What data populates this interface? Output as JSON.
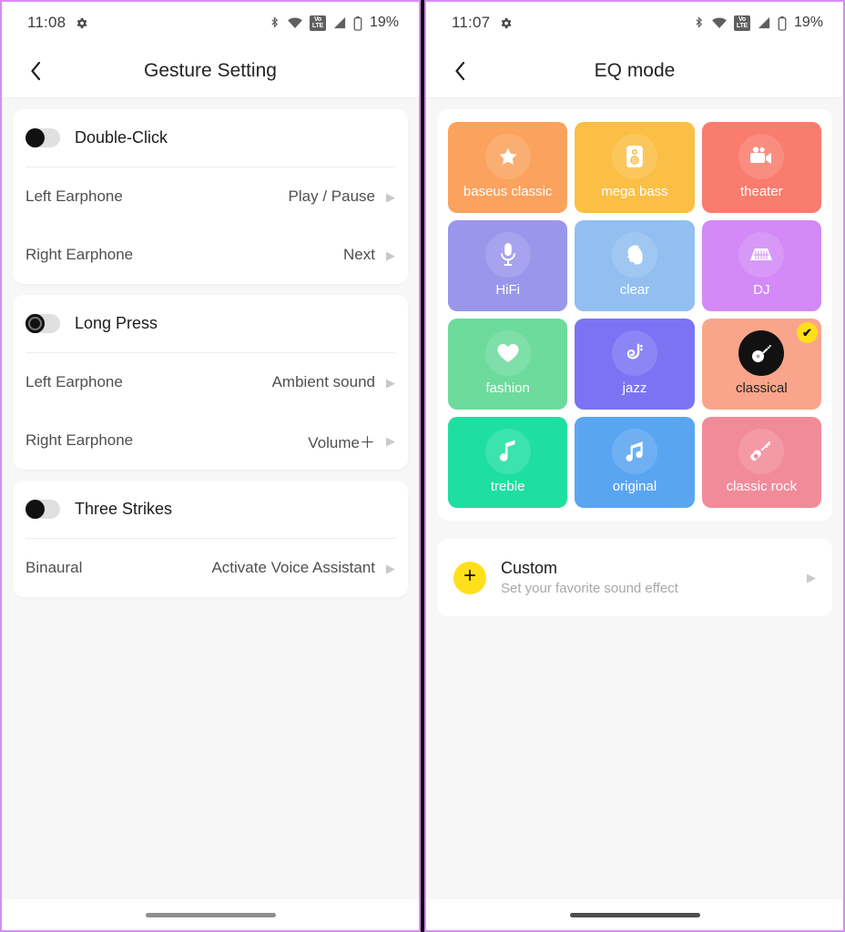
{
  "left": {
    "status": {
      "time": "11:08",
      "battery_pct": "19%",
      "volte_top": "Vo",
      "volte_bottom": "LTE",
      "icons": [
        "gear-icon",
        "bluetooth-icon",
        "wifi-icon",
        "volte-icon",
        "signal-icon",
        "battery-icon"
      ]
    },
    "title": "Gesture Setting",
    "back_label": "‹",
    "groups": [
      {
        "name": "Double-Click",
        "toggle_state": "off",
        "toggle_style": "plain",
        "rows": [
          {
            "label": "Left Earphone",
            "value": "Play / Pause"
          },
          {
            "label": "Right Earphone",
            "value": "Next"
          }
        ]
      },
      {
        "name": "Long Press",
        "toggle_state": "off",
        "toggle_style": "ring",
        "rows": [
          {
            "label": "Left Earphone",
            "value": "Ambient sound"
          },
          {
            "label": "Right Earphone",
            "value": "Volume＋"
          }
        ]
      },
      {
        "name": "Three Strikes",
        "toggle_state": "off",
        "toggle_style": "plain",
        "rows": [
          {
            "label": "Binaural",
            "value": "Activate Voice Assistant"
          }
        ]
      }
    ],
    "chevron": "▶"
  },
  "right": {
    "status": {
      "time": "11:07",
      "battery_pct": "19%",
      "volte_top": "Vo",
      "volte_bottom": "LTE",
      "icons": [
        "gear-icon",
        "bluetooth-icon",
        "wifi-icon",
        "volte-icon",
        "signal-icon",
        "battery-icon"
      ]
    },
    "title": "EQ mode",
    "back_label": "‹",
    "eq_modes": [
      {
        "label": "baseus classic",
        "icon": "star-icon",
        "color": "#FBA25E",
        "selected": false
      },
      {
        "label": "mega bass",
        "icon": "speaker-icon",
        "color": "#FBBF45",
        "selected": false
      },
      {
        "label": "theater",
        "icon": "movie-camera-icon",
        "color": "#F97C6E",
        "selected": false
      },
      {
        "label": "HiFi",
        "icon": "microphone-icon",
        "color": "#9A96EC",
        "selected": false
      },
      {
        "label": "clear",
        "icon": "head-profile-icon",
        "color": "#92BFF0",
        "selected": false
      },
      {
        "label": "DJ",
        "icon": "dj-mixer-icon",
        "color": "#D389F7",
        "selected": false
      },
      {
        "label": "fashion",
        "icon": "heart-icon",
        "color": "#6DDB9C",
        "selected": false
      },
      {
        "label": "jazz",
        "icon": "saxophone-icon",
        "color": "#7A74F5",
        "selected": false
      },
      {
        "label": "classical",
        "icon": "banjo-icon",
        "color": "#F9A58B",
        "selected": true
      },
      {
        "label": "treble",
        "icon": "music-note-icon",
        "color": "#1FDFA0",
        "selected": false
      },
      {
        "label": "original",
        "icon": "double-note-icon",
        "color": "#5AA5F2",
        "selected": false
      },
      {
        "label": "classic rock",
        "icon": "guitar-icon",
        "color": "#F28B99",
        "selected": false
      }
    ],
    "check_mark": "✔",
    "custom": {
      "title": "Custom",
      "subtitle": "Set your favorite sound effect",
      "plus": "+",
      "chevron": "▶"
    }
  }
}
